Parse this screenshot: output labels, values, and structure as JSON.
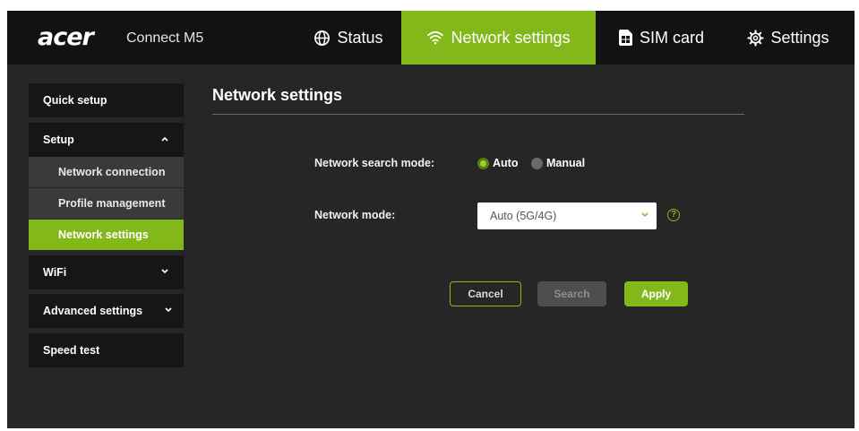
{
  "header": {
    "brand": "acer",
    "product": "Connect M5",
    "tabs": [
      {
        "label": "Status",
        "icon": "globe-icon",
        "active": false
      },
      {
        "label": "Network settings",
        "icon": "wifi-icon",
        "active": true
      },
      {
        "label": "SIM card",
        "icon": "sim-card-icon",
        "active": false
      },
      {
        "label": "Settings",
        "icon": "gear-icon",
        "active": false
      }
    ]
  },
  "sidebar": {
    "items": [
      {
        "label": "Quick setup"
      },
      {
        "label": "Setup",
        "expanded": true,
        "children": [
          {
            "label": "Network connection"
          },
          {
            "label": "Profile management"
          },
          {
            "label": "Network settings",
            "active": true
          }
        ]
      },
      {
        "label": "WiFi",
        "expanded": false
      },
      {
        "label": "Advanced settings",
        "expanded": false
      },
      {
        "label": "Speed test"
      }
    ]
  },
  "main": {
    "title": "Network settings",
    "search_mode": {
      "label": "Network search mode:",
      "options": [
        {
          "label": "Auto",
          "selected": true
        },
        {
          "label": "Manual",
          "selected": false
        }
      ]
    },
    "network_mode": {
      "label": "Network mode:",
      "value": "Auto (5G/4G)",
      "help": "?"
    },
    "buttons": {
      "cancel": "Cancel",
      "search": "Search",
      "apply": "Apply"
    }
  },
  "colors": {
    "accent": "#83b81a",
    "background": "#262626",
    "header": "#121212",
    "sidebar": "#161616",
    "sidebar_sub": "#3a3a3a"
  }
}
